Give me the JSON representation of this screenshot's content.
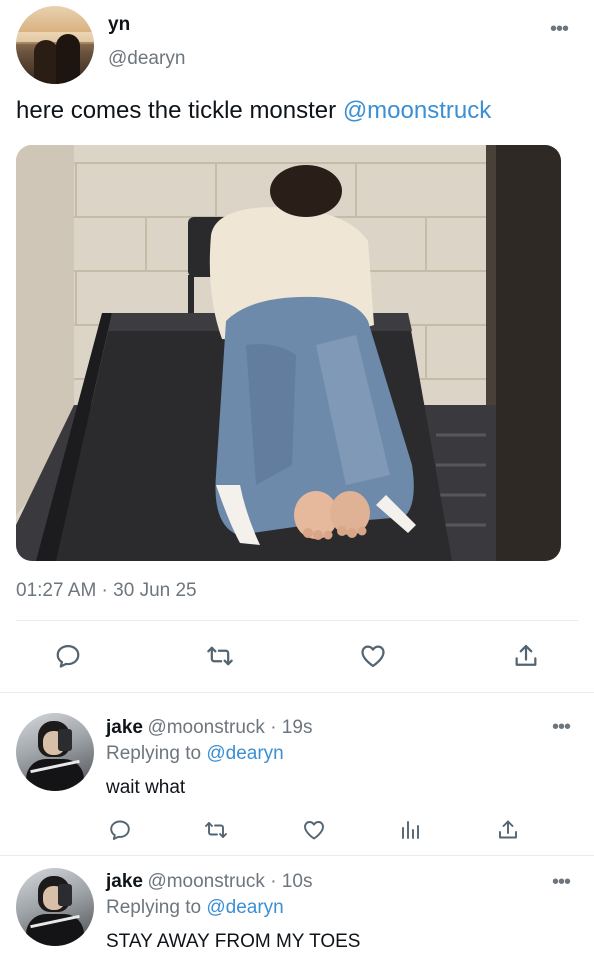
{
  "tweet": {
    "author_name": "yn",
    "author_handle": "@dearyn",
    "text": "here comes the tickle monster ",
    "mention": "@moonstruck",
    "timestamp": "01:27 AM · 30 Jun 25",
    "more": "•••"
  },
  "actions": [
    "reply-icon",
    "retweet-icon",
    "like-icon",
    "share-icon"
  ],
  "replies": [
    {
      "name": "jake",
      "handle_time": "@moonstruck · 19s",
      "replying_prefix": "Replying to ",
      "replying_to": "@dearyn",
      "text": "wait what",
      "more": "•••"
    },
    {
      "name": "jake",
      "handle_time": "@moonstruck · 10s",
      "replying_prefix": "Replying to ",
      "replying_to": "@dearyn",
      "text": "STAY AWAY FROM MY TOES",
      "more": "•••"
    }
  ],
  "colors": {
    "accent": "#3b8fd4",
    "secondary_text": "#6e767d",
    "divider": "#e6ecf0"
  }
}
